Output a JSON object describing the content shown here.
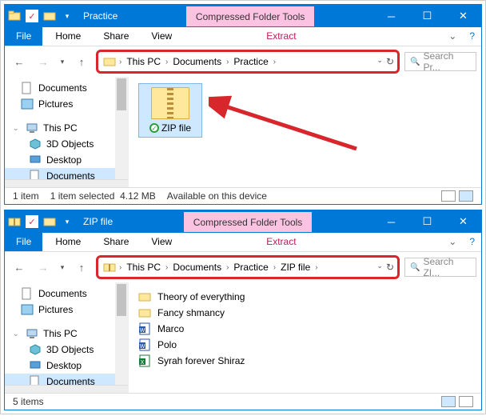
{
  "win1": {
    "title": "Practice",
    "tooltab": "Compressed Folder Tools",
    "ribbon": {
      "file": "File",
      "home": "Home",
      "share": "Share",
      "view": "View",
      "extract": "Extract"
    },
    "breadcrumb": [
      "This PC",
      "Documents",
      "Practice"
    ],
    "search_placeholder": "Search Pr...",
    "sidebar": {
      "documents": "Documents",
      "pictures": "Pictures",
      "thispc": "This PC",
      "objects3d": "3D Objects",
      "desktop": "Desktop",
      "docs_sel": "Documents"
    },
    "item": {
      "name": "ZIP file"
    },
    "status": {
      "count": "1 item",
      "selected": "1 item selected",
      "size": "4.12 MB",
      "avail": "Available on this device"
    }
  },
  "win2": {
    "title": "ZIP file",
    "tooltab": "Compressed Folder Tools",
    "ribbon": {
      "file": "File",
      "home": "Home",
      "share": "Share",
      "view": "View",
      "extract": "Extract"
    },
    "breadcrumb": [
      "This PC",
      "Documents",
      "Practice",
      "ZIP file"
    ],
    "search_placeholder": "Search ZI...",
    "sidebar": {
      "documents": "Documents",
      "pictures": "Pictures",
      "thispc": "This PC",
      "objects3d": "3D Objects",
      "desktop": "Desktop",
      "docs_sel": "Documents"
    },
    "files": [
      {
        "name": "Theory of everything",
        "type": "folder"
      },
      {
        "name": "Fancy shmancy",
        "type": "folder"
      },
      {
        "name": "Marco",
        "type": "word"
      },
      {
        "name": "Polo",
        "type": "word"
      },
      {
        "name": "Syrah forever Shiraz",
        "type": "excel"
      }
    ],
    "status": {
      "count": "5 items"
    }
  }
}
